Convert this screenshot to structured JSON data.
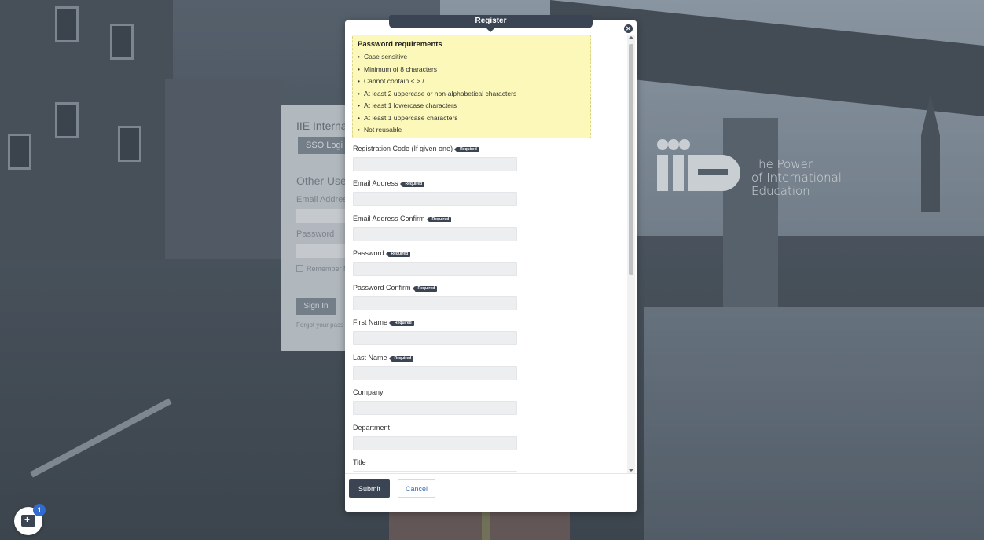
{
  "background_login": {
    "title": "IIE Interna",
    "sso_label": "SSO Logi",
    "other_users_heading": "Other User",
    "email_label": "Email Addres",
    "password_label": "Password",
    "remember_label": "Remember M",
    "sign_in_label": "Sign In",
    "forgot_label": "Forgot your pass"
  },
  "logo": {
    "line1": "The Power",
    "line2": "of International",
    "line3": "Education"
  },
  "modal": {
    "title": "Register",
    "close_icon": "close-icon",
    "requirements": {
      "title": "Password requirements",
      "items": [
        "Case sensitive",
        "Minimum of 8 characters",
        "Cannot contain < > /",
        "At least 2 uppercase or non-alphabetical characters",
        "At least 1 lowercase characters",
        "At least 1 uppercase characters",
        "Not reusable"
      ]
    },
    "required_badge": "Required",
    "fields": [
      {
        "label": "Registration Code (If given one)",
        "required": true,
        "value": ""
      },
      {
        "label": "Email Address",
        "required": true,
        "value": ""
      },
      {
        "label": "Email Address Confirm",
        "required": true,
        "value": ""
      },
      {
        "label": "Password",
        "required": true,
        "value": ""
      },
      {
        "label": "Password Confirm",
        "required": true,
        "value": ""
      },
      {
        "label": "First Name",
        "required": true,
        "value": ""
      },
      {
        "label": "Last Name",
        "required": true,
        "value": ""
      },
      {
        "label": "Company",
        "required": false,
        "value": ""
      },
      {
        "label": "Department",
        "required": false,
        "value": ""
      },
      {
        "label": "Title",
        "required": false,
        "value": ""
      }
    ],
    "submit_label": "Submit",
    "cancel_label": "Cancel"
  },
  "chat": {
    "icon": "chat-icon",
    "count": "1"
  },
  "colors": {
    "primary": "#3a4452",
    "requirements_bg": "#fbf8b9",
    "link": "#3b6fb1",
    "chat_badge": "#2f6bd0"
  }
}
